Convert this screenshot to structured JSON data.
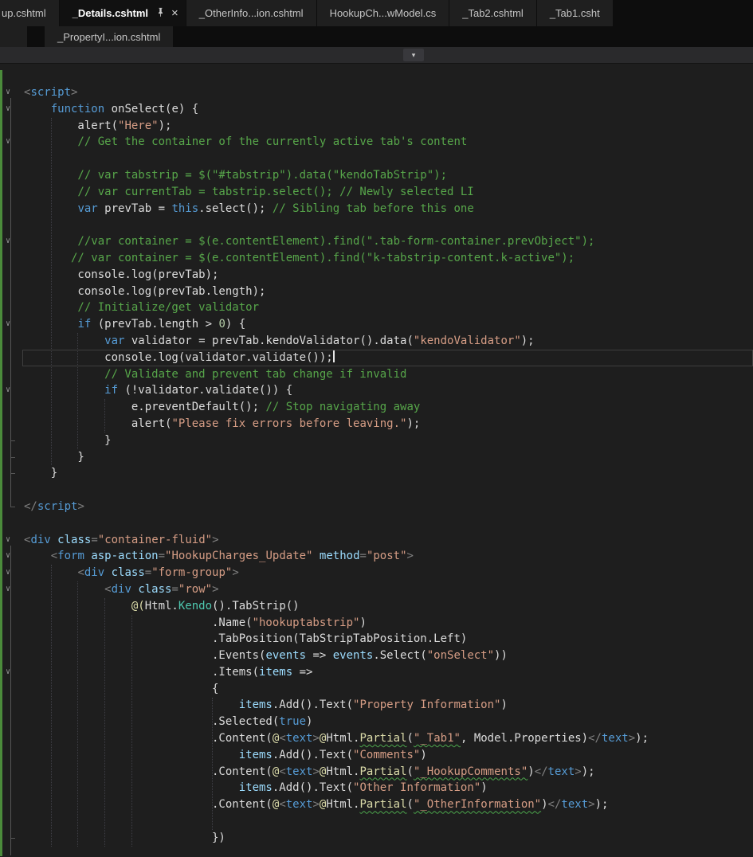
{
  "colors": {
    "editor_bg": "#1e1e1e",
    "tab_bar_bg": "#0d0d0d",
    "tab_inactive_bg": "#1f1f1f",
    "tab_active_bg": "#111111",
    "tab_text": "#c4c4c4",
    "tab_active_text": "#ffffff",
    "change_bar_green": "#4b8b3b",
    "keyword": "#569cd6",
    "string": "#d69d85",
    "comment": "#57a64a",
    "punctuation": "#808080",
    "type": "#4ec9b0",
    "parameter": "#9cdcfe",
    "method": "#dcdcaa",
    "number": "#b5cea8",
    "squiggle": "#4ca64c"
  },
  "tab_bar": {
    "close_glyph": "×",
    "row1": [
      {
        "label": "up.cshtml",
        "state": "inactive",
        "cut_left": true
      },
      {
        "label": "_Details.cshtml",
        "state": "active",
        "pinned": true,
        "closable": true
      },
      {
        "label": "_OtherInfo...ion.cshtml",
        "state": "inactive"
      },
      {
        "label": "HookupCh...wModel.cs",
        "state": "inactive"
      },
      {
        "label": "_Tab2.cshtml",
        "state": "inactive"
      },
      {
        "label": "_Tab1.csht",
        "state": "inactive"
      }
    ],
    "row2": [
      {
        "label": "",
        "state": "inactive",
        "sliver": true
      },
      {
        "label": "_PropertyI...ion.cshtml",
        "state": "inactive"
      }
    ]
  },
  "navbar": {
    "dropdown_glyph": "▾"
  },
  "editor": {
    "icons": {
      "fold_open": "∨"
    },
    "current_line": 17,
    "lines": [
      {
        "f": 1,
        "t": [
          [
            "g",
            "<"
          ],
          [
            "k",
            "script"
          ],
          [
            "g",
            ">"
          ]
        ]
      },
      {
        "f": 1,
        "t": [
          [
            "p",
            "    "
          ],
          [
            "k",
            "function"
          ],
          [
            "p",
            " onSelect(e) {"
          ]
        ]
      },
      {
        "t": [
          [
            "p",
            "        alert("
          ],
          [
            "s",
            "\"Here\""
          ],
          [
            "p",
            ");"
          ]
        ]
      },
      {
        "f": 1,
        "t": [
          [
            "c",
            "        // Get the container of the currently active tab's content"
          ]
        ]
      },
      {
        "t": []
      },
      {
        "t": [
          [
            "c",
            "        // var tabstrip = $(\"#tabstrip\").data(\"kendoTabStrip\");"
          ]
        ]
      },
      {
        "t": [
          [
            "c",
            "        // var currentTab = tabstrip.select(); // Newly selected LI"
          ]
        ]
      },
      {
        "t": [
          [
            "p",
            "        "
          ],
          [
            "k",
            "var"
          ],
          [
            "p",
            " prevTab = "
          ],
          [
            "k",
            "this"
          ],
          [
            "p",
            ".select(); "
          ],
          [
            "c",
            "// Sibling tab before this one"
          ]
        ]
      },
      {
        "t": []
      },
      {
        "f": 1,
        "t": [
          [
            "c",
            "        //var container = $(e.contentElement).find(\".tab-form-container.prevObject\");"
          ]
        ]
      },
      {
        "t": [
          [
            "c",
            "       // var container = $(e.contentElement).find(\"k-tabstrip-content.k-active\");"
          ]
        ]
      },
      {
        "t": [
          [
            "p",
            "        console.log(prevTab);"
          ]
        ]
      },
      {
        "t": [
          [
            "p",
            "        console.log(prevTab.length);"
          ]
        ]
      },
      {
        "t": [
          [
            "c",
            "        // Initialize/get validator"
          ]
        ]
      },
      {
        "f": 1,
        "t": [
          [
            "p",
            "        "
          ],
          [
            "k",
            "if"
          ],
          [
            "p",
            " (prevTab.length > "
          ],
          [
            "n",
            "0"
          ],
          [
            "p",
            ") {"
          ]
        ]
      },
      {
        "t": [
          [
            "p",
            "            "
          ],
          [
            "k",
            "var"
          ],
          [
            "p",
            " validator = prevTab.kendoValidator().data("
          ],
          [
            "s",
            "\"kendoValidator\""
          ],
          [
            "p",
            ");"
          ]
        ]
      },
      {
        "caret": 1,
        "t": [
          [
            "p",
            "            console.log(validator.validate());"
          ]
        ]
      },
      {
        "t": [
          [
            "c",
            "            // Validate and prevent tab change if invalid"
          ]
        ]
      },
      {
        "f": 1,
        "t": [
          [
            "p",
            "            "
          ],
          [
            "k",
            "if"
          ],
          [
            "p",
            " (!validator.validate()) {"
          ]
        ]
      },
      {
        "t": [
          [
            "p",
            "                e.preventDefault(); "
          ],
          [
            "c",
            "// Stop navigating away"
          ]
        ]
      },
      {
        "t": [
          [
            "p",
            "                alert("
          ],
          [
            "s",
            "\"Please fix errors before leaving.\""
          ],
          [
            "p",
            ");"
          ]
        ]
      },
      {
        "t": [
          [
            "p",
            "            }"
          ]
        ]
      },
      {
        "t": [
          [
            "p",
            "        }"
          ]
        ]
      },
      {
        "t": [
          [
            "p",
            "    }"
          ]
        ]
      },
      {
        "t": []
      },
      {
        "t": [
          [
            "g",
            "</"
          ],
          [
            "k",
            "script"
          ],
          [
            "g",
            ">"
          ]
        ]
      },
      {
        "t": []
      },
      {
        "f": 1,
        "t": [
          [
            "g",
            "<"
          ],
          [
            "k",
            "div"
          ],
          [
            "p",
            " "
          ],
          [
            "v",
            "class"
          ],
          [
            "g",
            "="
          ],
          [
            "s",
            "\"container-fluid\""
          ],
          [
            "g",
            ">"
          ]
        ]
      },
      {
        "f": 1,
        "t": [
          [
            "p",
            "    "
          ],
          [
            "g",
            "<"
          ],
          [
            "k",
            "form"
          ],
          [
            "p",
            " "
          ],
          [
            "v",
            "asp-action"
          ],
          [
            "g",
            "="
          ],
          [
            "s",
            "\"HookupCharges_Update\""
          ],
          [
            "p",
            " "
          ],
          [
            "v",
            "method"
          ],
          [
            "g",
            "="
          ],
          [
            "s",
            "\"post\""
          ],
          [
            "g",
            ">"
          ]
        ]
      },
      {
        "f": 1,
        "t": [
          [
            "p",
            "        "
          ],
          [
            "g",
            "<"
          ],
          [
            "k",
            "div"
          ],
          [
            "p",
            " "
          ],
          [
            "v",
            "class"
          ],
          [
            "g",
            "="
          ],
          [
            "s",
            "\"form-group\""
          ],
          [
            "g",
            ">"
          ]
        ]
      },
      {
        "f": 1,
        "t": [
          [
            "p",
            "            "
          ],
          [
            "g",
            "<"
          ],
          [
            "k",
            "div"
          ],
          [
            "p",
            " "
          ],
          [
            "v",
            "class"
          ],
          [
            "g",
            "="
          ],
          [
            "s",
            "\"row\""
          ],
          [
            "g",
            ">"
          ]
        ]
      },
      {
        "t": [
          [
            "p",
            "                "
          ],
          [
            "m",
            "@("
          ],
          [
            "p",
            "Html."
          ],
          [
            "t2",
            "Kendo"
          ],
          [
            "p",
            "().TabStrip()"
          ]
        ]
      },
      {
        "t": [
          [
            "p",
            "                            .Name("
          ],
          [
            "s",
            "\"hookuptabstrip\""
          ],
          [
            "p",
            ")"
          ]
        ]
      },
      {
        "t": [
          [
            "p",
            "                            .TabPosition(TabStripTabPosition.Left)"
          ]
        ]
      },
      {
        "t": [
          [
            "p",
            "                            .Events("
          ],
          [
            "v",
            "events"
          ],
          [
            "p",
            " => "
          ],
          [
            "v",
            "events"
          ],
          [
            "p",
            ".Select("
          ],
          [
            "s",
            "\"onSelect\""
          ],
          [
            "p",
            "))"
          ]
        ]
      },
      {
        "f": 1,
        "t": [
          [
            "p",
            "                            .Items("
          ],
          [
            "v",
            "items"
          ],
          [
            "p",
            " =>"
          ]
        ]
      },
      {
        "t": [
          [
            "p",
            "                            {"
          ]
        ]
      },
      {
        "t": [
          [
            "p",
            "                                "
          ],
          [
            "v",
            "items"
          ],
          [
            "p",
            ".Add().Text("
          ],
          [
            "s",
            "\"Property Information\""
          ],
          [
            "p",
            ")"
          ]
        ]
      },
      {
        "t": [
          [
            "p",
            "                            .Selected("
          ],
          [
            "k",
            "true"
          ],
          [
            "p",
            ")"
          ]
        ]
      },
      {
        "t": [
          [
            "p",
            "                            .Content("
          ],
          [
            "m",
            "@"
          ],
          [
            "g",
            "<"
          ],
          [
            "k",
            "text"
          ],
          [
            "g",
            ">"
          ],
          [
            "m",
            "@"
          ],
          [
            "p",
            "Html."
          ],
          [
            "m",
            "Partial",
            "sq"
          ],
          [
            "p",
            "("
          ],
          [
            "s",
            "\"_Tab1\"",
            "sq"
          ],
          [
            "p",
            ", Model.Properties)"
          ],
          [
            "g",
            "</"
          ],
          [
            "k",
            "text"
          ],
          [
            "g",
            ">"
          ],
          [
            "p",
            ");"
          ]
        ]
      },
      {
        "t": [
          [
            "p",
            "                                "
          ],
          [
            "v",
            "items"
          ],
          [
            "p",
            ".Add().Text("
          ],
          [
            "s",
            "\"Comments\""
          ],
          [
            "p",
            ")"
          ]
        ]
      },
      {
        "t": [
          [
            "p",
            "                            .Content("
          ],
          [
            "m",
            "@"
          ],
          [
            "g",
            "<"
          ],
          [
            "k",
            "text"
          ],
          [
            "g",
            ">"
          ],
          [
            "m",
            "@"
          ],
          [
            "p",
            "Html."
          ],
          [
            "m",
            "Partial",
            "sq"
          ],
          [
            "p",
            "("
          ],
          [
            "s",
            "\"_HookupComments\"",
            "sq"
          ],
          [
            "p",
            ")"
          ],
          [
            "g",
            "</"
          ],
          [
            "k",
            "text"
          ],
          [
            "g",
            ">"
          ],
          [
            "p",
            ");"
          ]
        ]
      },
      {
        "t": [
          [
            "p",
            "                                "
          ],
          [
            "v",
            "items"
          ],
          [
            "p",
            ".Add().Text("
          ],
          [
            "s",
            "\"Other Information\""
          ],
          [
            "p",
            ")"
          ]
        ]
      },
      {
        "t": [
          [
            "p",
            "                            .Content("
          ],
          [
            "m",
            "@"
          ],
          [
            "g",
            "<"
          ],
          [
            "k",
            "text"
          ],
          [
            "g",
            ">"
          ],
          [
            "m",
            "@"
          ],
          [
            "p",
            "Html."
          ],
          [
            "m",
            "Partial",
            "sq"
          ],
          [
            "p",
            "("
          ],
          [
            "s",
            "\"_OtherInformation\"",
            "sq"
          ],
          [
            "p",
            ")"
          ],
          [
            "g",
            "</"
          ],
          [
            "k",
            "text"
          ],
          [
            "g",
            ">"
          ],
          [
            "p",
            ");"
          ]
        ]
      },
      {
        "t": []
      },
      {
        "t": [
          [
            "p",
            "                            })"
          ]
        ]
      }
    ],
    "guides": [
      {
        "c": 4,
        "f": 3,
        "t": 23
      },
      {
        "c": 8,
        "f": 16,
        "t": 22
      },
      {
        "c": 12,
        "f": 20,
        "t": 21
      },
      {
        "c": 4,
        "f": 30,
        "t": 46
      },
      {
        "c": 8,
        "f": 31,
        "t": 46
      },
      {
        "c": 12,
        "f": 32,
        "t": 46
      },
      {
        "c": 16,
        "f": 33,
        "t": 46
      },
      {
        "c": 28,
        "f": 38,
        "t": 45
      }
    ],
    "fold_ranges": [
      {
        "f": 1,
        "t": 26
      },
      {
        "f": 2,
        "t": 24
      },
      {
        "f": 15,
        "t": 23
      },
      {
        "f": 19,
        "t": 22
      },
      {
        "f": 28,
        "t": 47
      },
      {
        "f": 36,
        "t": 46
      }
    ]
  }
}
